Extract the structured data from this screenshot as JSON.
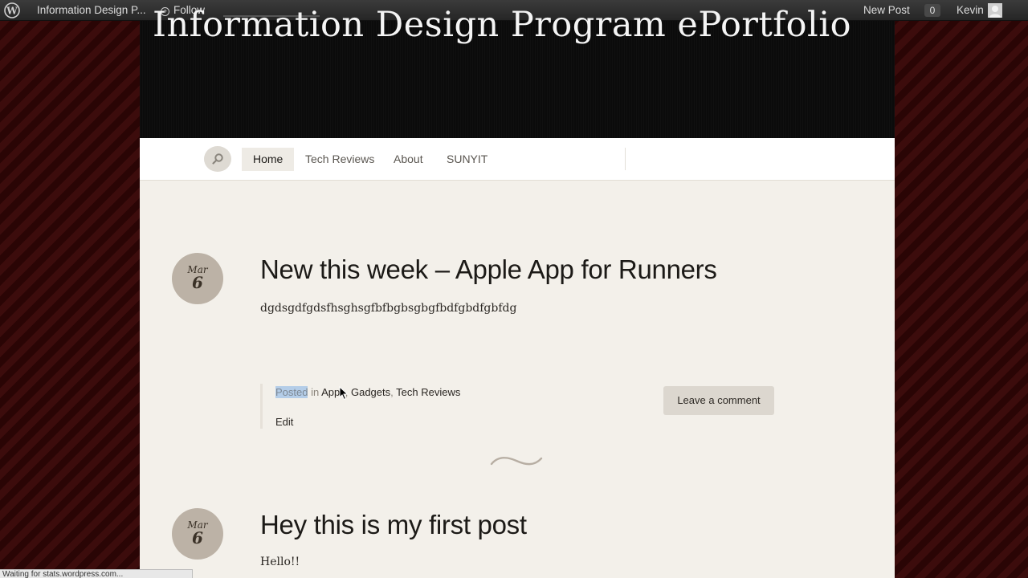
{
  "adminbar": {
    "site_name": "Information Design P...",
    "follow_label": "Follow",
    "new_post_label": "New Post",
    "notification_count": "0",
    "user_name": "Kevin"
  },
  "header": {
    "site_title": "Information Design Program ePortfolio"
  },
  "nav": {
    "items": [
      {
        "label": "Home",
        "active": true
      },
      {
        "label": "Tech Reviews"
      },
      {
        "label": "About"
      },
      {
        "label": "SUNYIT"
      }
    ]
  },
  "posts": [
    {
      "month": "Mar",
      "day": "6",
      "title": "New this week – Apple App for Runners",
      "body": "dgdsgdfgdsfhsghsgfbfbgbsgbgfbdfgbdfgbfdg",
      "posted_prefix_selected": "Posted",
      "posted_in": " in ",
      "categories": [
        "Apps",
        "Gadgets",
        "Tech Reviews"
      ],
      "sep": ", ",
      "edit_label": "Edit",
      "comment_label": "Leave a comment"
    },
    {
      "month": "Mar",
      "day": "6",
      "title": "Hey this is my first post",
      "body": "Hello!!"
    }
  ],
  "status_text": "Waiting for stats.wordpress.com..."
}
